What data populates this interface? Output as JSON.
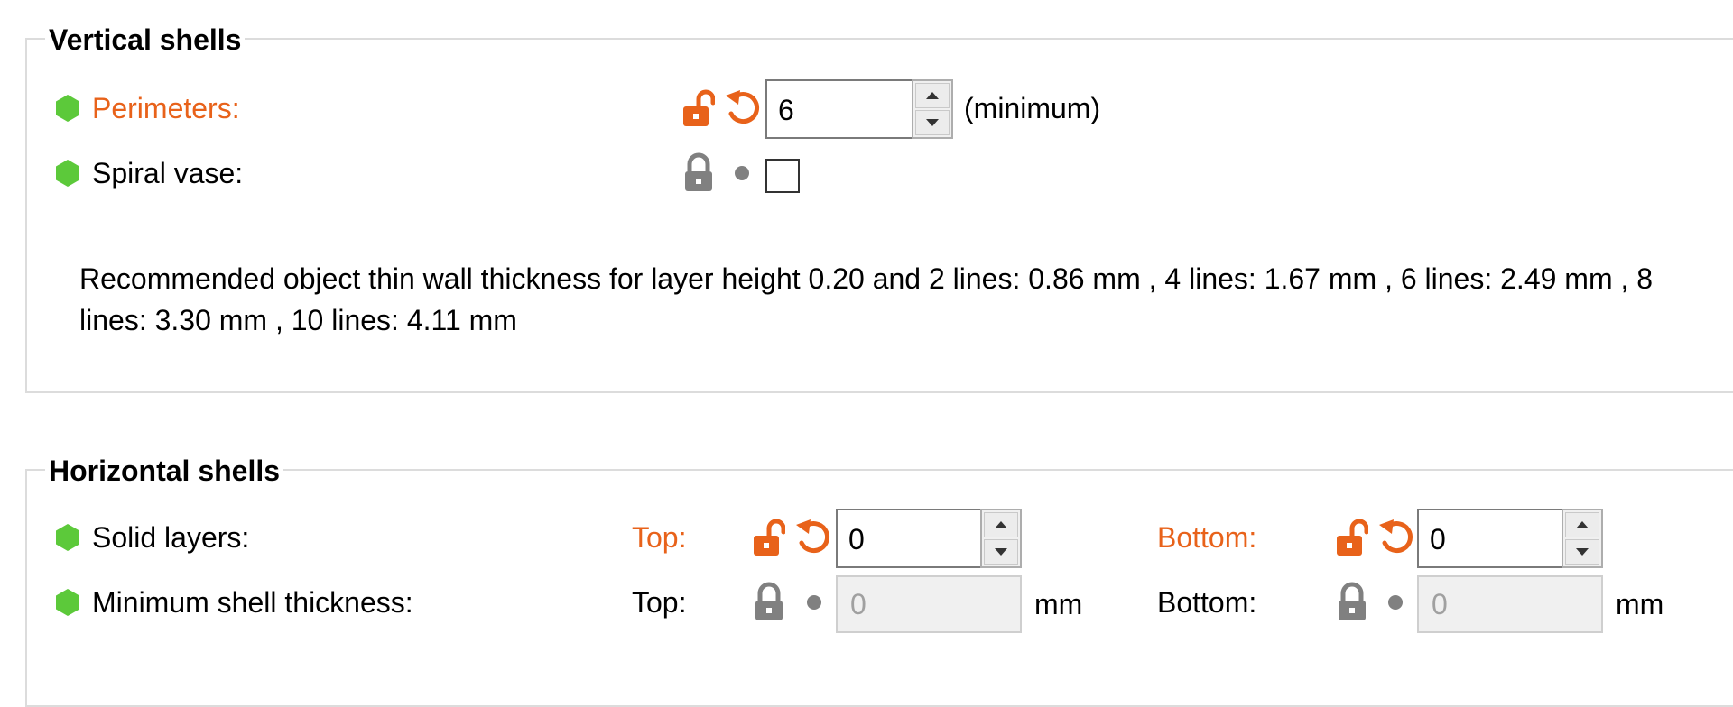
{
  "vertical_shells": {
    "title": "Vertical shells",
    "perimeters": {
      "label": "Perimeters:",
      "value": "6",
      "suffix": "(minimum)",
      "status_icon": "green-hexagon-icon",
      "lock_icon": "unlocked-lock-icon",
      "reset_icon": "undo-arrow-icon"
    },
    "spiral_vase": {
      "label": "Spiral vase:",
      "checked": false,
      "status_icon": "green-hexagon-icon",
      "lock_icon": "locked-lock-icon",
      "reset_icon": "bullet-dot-icon"
    },
    "recommendation": "Recommended object thin wall thickness for layer height 0.20 and 2 lines: 0.86 mm , 4 lines: 1.67 mm , 6 lines: 2.49 mm , 8 lines: 3.30 mm , 10 lines: 4.11 mm"
  },
  "horizontal_shells": {
    "title": "Horizontal shells",
    "solid_layers": {
      "label": "Solid layers:",
      "top_label": "Top:",
      "top_value": "0",
      "bottom_label": "Bottom:",
      "bottom_value": "0"
    },
    "min_shell_thickness": {
      "label": "Minimum shell thickness:",
      "top_label": "Top:",
      "top_value": "0",
      "top_unit": "mm",
      "bottom_label": "Bottom:",
      "bottom_value": "0",
      "bottom_unit": "mm"
    }
  },
  "colors": {
    "modified": "#e8621a",
    "ok_status": "#5cc93a",
    "locked_gray": "#808080",
    "group_border": "#dcdcdc"
  }
}
